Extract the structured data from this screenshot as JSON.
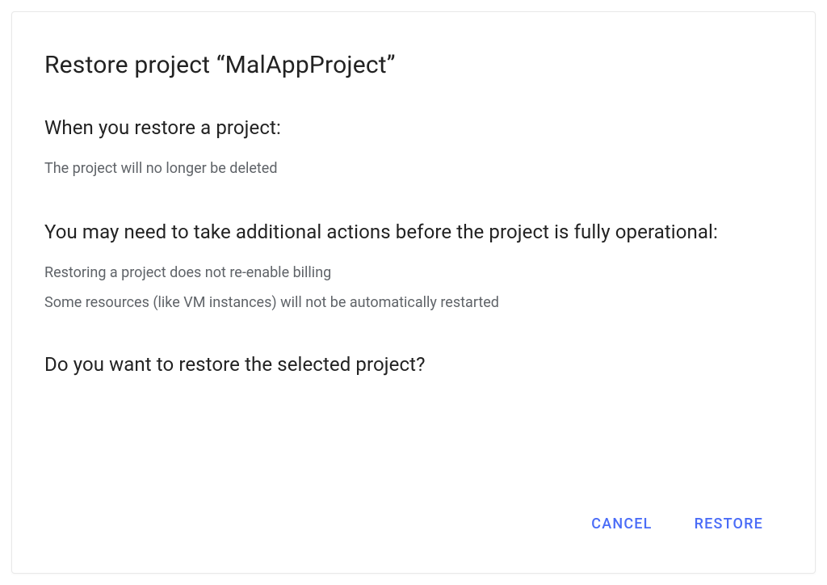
{
  "dialog": {
    "title": "Restore project “MalAppProject”",
    "section1": {
      "heading": "When you restore a project:",
      "line1": "The project will no longer be deleted"
    },
    "section2": {
      "heading": "You may need to take additional actions before the project is fully operational:",
      "line1": "Restoring a project does not re-enable billing",
      "line2": "Some resources (like VM instances) will not be automatically restarted"
    },
    "confirm": "Do you want to restore the selected project?",
    "buttons": {
      "cancel": "CANCEL",
      "restore": "RESTORE"
    }
  }
}
